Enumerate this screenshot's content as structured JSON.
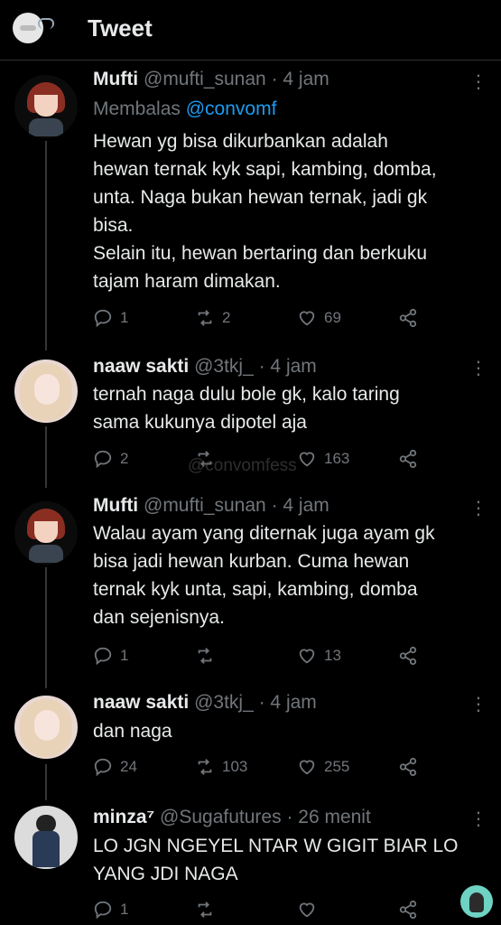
{
  "header": {
    "title": "Tweet"
  },
  "tweets": [
    {
      "name": "Mufti",
      "handle": "@mufti_sunan",
      "time": "· 4 jam",
      "reply_prefix": "Membalas",
      "reply_handle": "@convomf",
      "text": "Hewan yg bisa dikurbankan adalah\nhewan ternak kyk sapi, kambing, domba,\nunta. Naga bukan hewan ternak, jadi gk\nbisa.\nSelain itu, hewan bertaring dan berkuku\ntajam haram dimakan.",
      "replies": "1",
      "retweets": "2",
      "likes": "69"
    },
    {
      "name": "naaw sakti",
      "handle": "@3tkj_",
      "time": "· 4 jam",
      "text": "ternah naga dulu bole gk, kalo taring\nsama kukunya dipotel aja",
      "replies": "2",
      "retweets": "",
      "likes": "163"
    },
    {
      "name": "Mufti",
      "handle": "@mufti_sunan",
      "time": "· 4 jam",
      "text": "Walau ayam yang diternak juga ayam gk\nbisa jadi hewan kurban. Cuma hewan\nternak kyk unta, sapi, kambing, domba\ndan sejenisnya.",
      "replies": "1",
      "retweets": "",
      "likes": "13"
    },
    {
      "name": "naaw sakti",
      "handle": "@3tkj_",
      "time": "· 4 jam",
      "text": "dan naga",
      "replies": "24",
      "retweets": "103",
      "likes": "255"
    },
    {
      "name": "minza⁷",
      "handle": "@Sugafutures",
      "time": "· 26 menit",
      "text": "LO JGN NGEYEL NTAR W GIGIT BIAR LO\nYANG JDI NAGA",
      "replies": "1",
      "retweets": "",
      "likes": ""
    }
  ],
  "watermark": "@convomfess",
  "icons": {
    "reply": "reply-icon",
    "retweet": "retweet-icon",
    "like": "heart-icon",
    "share": "share-icon",
    "more": "more-icon"
  },
  "colors": {
    "background": "#000000",
    "text": "#e7e9ea",
    "secondary": "#71767b",
    "link": "#1d9bf0"
  }
}
